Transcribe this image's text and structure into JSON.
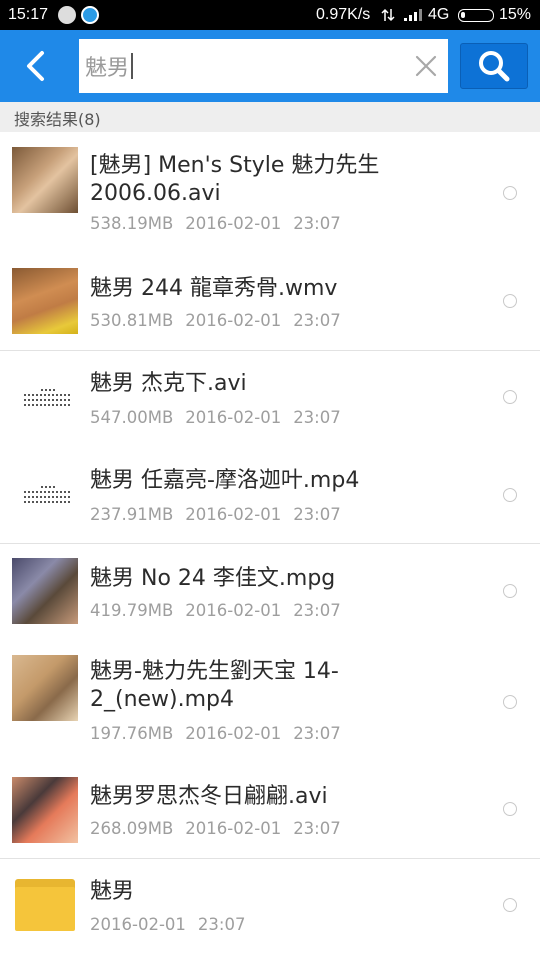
{
  "status_bar": {
    "time": "15:17",
    "speed": "0.97K/s",
    "network": "4G",
    "battery": "15%"
  },
  "search": {
    "query": "魅男",
    "back_icon": "chevron-left-icon",
    "clear_icon": "close-icon",
    "search_icon": "search-icon"
  },
  "results_header": "搜索结果(8)",
  "colors": {
    "accent": "#1f89e8",
    "search_button": "#0d72d6",
    "folder": "#f5c53b"
  },
  "results": [
    {
      "name": "[魅男] Men's Style 魅力先生 2006.06.avi",
      "size": "538.19MB",
      "date": "2016-02-01",
      "time": "23:07",
      "thumb": "video-thumbnail"
    },
    {
      "name": "魅男 244 龍章秀骨.wmv",
      "size": "530.81MB",
      "date": "2016-02-01",
      "time": "23:07",
      "thumb": "video-thumbnail"
    },
    {
      "name": "魅男 杰克下.avi",
      "size": "547.00MB",
      "date": "2016-02-01",
      "time": "23:07",
      "thumb": "document-thumbnail"
    },
    {
      "name": "魅男 任嘉亮-摩洛迦叶.mp4",
      "size": "237.91MB",
      "date": "2016-02-01",
      "time": "23:07",
      "thumb": "document-thumbnail"
    },
    {
      "name": "魅男 No 24 李佳文.mpg",
      "size": "419.79MB",
      "date": "2016-02-01",
      "time": "23:07",
      "thumb": "video-thumbnail"
    },
    {
      "name": "魅男-魅力先生劉天宝 14-2_(new).mp4",
      "size": "197.76MB",
      "date": "2016-02-01",
      "time": "23:07",
      "thumb": "video-thumbnail"
    },
    {
      "name": "魅男罗思杰冬日翩翩.avi",
      "size": "268.09MB",
      "date": "2016-02-01",
      "time": "23:07",
      "thumb": "video-thumbnail"
    },
    {
      "name": "魅男",
      "date": "2016-02-01",
      "time": "23:07",
      "thumb": "folder-icon"
    }
  ]
}
